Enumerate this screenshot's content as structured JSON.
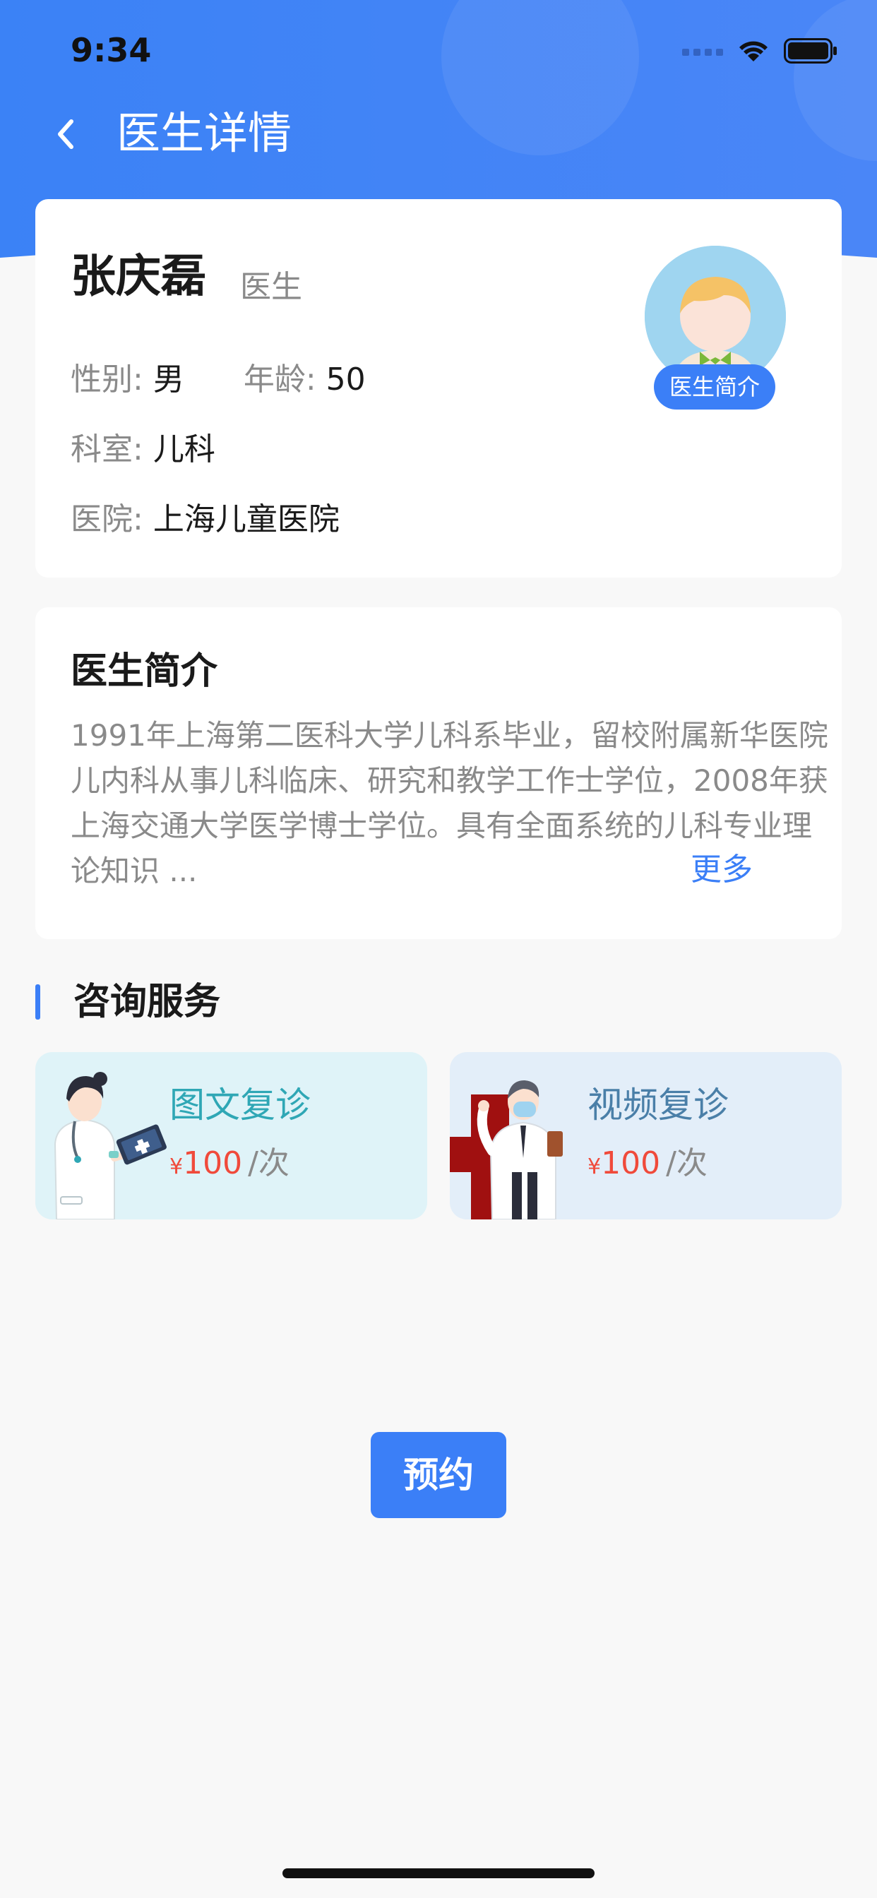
{
  "status_bar": {
    "time": "9:34"
  },
  "nav": {
    "title": "医生详情"
  },
  "doctor": {
    "name": "张庆磊",
    "title": "医生",
    "gender_label": "性别:",
    "gender": "男",
    "age_label": "年龄:",
    "age": "50",
    "department_label": "科室:",
    "department": "儿科",
    "hospital_label": "医院:",
    "hospital": "上海儿童医院",
    "intro_badge": "医生简介"
  },
  "intro": {
    "title": "医生简介",
    "text": "1991年上海第二医科大学儿科系毕业，留校附属新华医院儿内科从事儿科临床、研究和教学工作士学位，2008年获上海交通大学医学博士学位。具有全面系统的儿科专业理论知识 ...",
    "more": "更多"
  },
  "services": {
    "title": "咨询服务",
    "items": [
      {
        "name": "图文复诊",
        "currency": "¥",
        "price": "100",
        "unit": "/次"
      },
      {
        "name": "视频复诊",
        "currency": "¥",
        "price": "100",
        "unit": "/次"
      }
    ]
  },
  "book_button": "预约",
  "colors": {
    "primary": "#3b7ff7",
    "price": "#f04a3b",
    "teal": "#2fa7b5"
  }
}
